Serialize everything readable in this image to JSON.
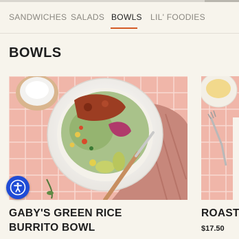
{
  "tabs": [
    {
      "label": "SANDWICHES"
    },
    {
      "label": "SALADS"
    },
    {
      "label": "BOWLS"
    },
    {
      "label": "LIL' FOODIES"
    }
  ],
  "active_tab": "BOWLS",
  "section_title": "BOWLS",
  "cards": [
    {
      "name": "GABY'S GREEN RICE BURRITO BOWL",
      "price": ""
    },
    {
      "name": "ROASTE",
      "price": "$17.50"
    }
  ],
  "accessibility_button": {
    "icon": "accessibility-icon"
  },
  "colors": {
    "background": "#f7f4ec",
    "accent": "#d45a24",
    "tile_pink": "#f0b5a8",
    "accessibility_blue": "#1f4bd6"
  }
}
